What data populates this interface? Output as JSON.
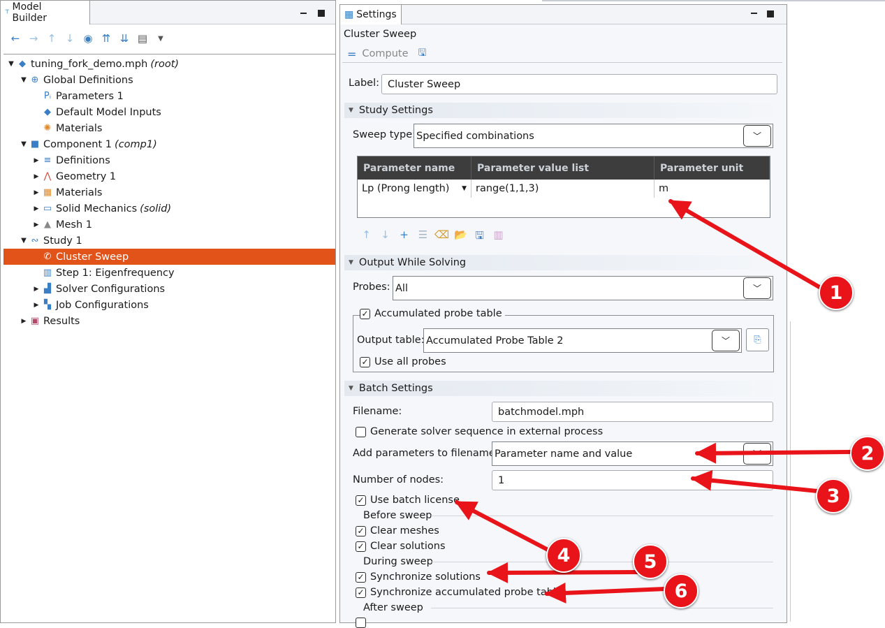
{
  "model_builder": {
    "tab_title": "Model Builder",
    "tree": [
      {
        "label": "tuning_fork_demo.mph",
        "suffix": "(root)",
        "level": 0,
        "expanded": true,
        "icon": "model-icon"
      },
      {
        "label": "Global Definitions",
        "suffix": "",
        "level": 1,
        "expanded": true,
        "icon": "globe-icon"
      },
      {
        "label": "Parameters 1",
        "suffix": "",
        "level": 2,
        "leaf": true,
        "icon": "parameters-icon"
      },
      {
        "label": "Default Model Inputs",
        "suffix": "",
        "level": 2,
        "leaf": true,
        "icon": "model-inputs-icon"
      },
      {
        "label": "Materials",
        "suffix": "",
        "level": 2,
        "leaf": true,
        "icon": "materials-global-icon"
      },
      {
        "label": "Component 1",
        "suffix": "(comp1)",
        "level": 1,
        "expanded": true,
        "icon": "component-icon"
      },
      {
        "label": "Definitions",
        "suffix": "",
        "level": 2,
        "expanded": false,
        "icon": "definitions-icon"
      },
      {
        "label": "Geometry 1",
        "suffix": "",
        "level": 2,
        "expanded": false,
        "icon": "geometry-icon"
      },
      {
        "label": "Materials",
        "suffix": "",
        "level": 2,
        "expanded": false,
        "icon": "materials-icon"
      },
      {
        "label": "Solid Mechanics",
        "suffix": "(solid)",
        "level": 2,
        "expanded": false,
        "icon": "solid-mechanics-icon"
      },
      {
        "label": "Mesh 1",
        "suffix": "",
        "level": 2,
        "expanded": false,
        "icon": "mesh-icon"
      },
      {
        "label": "Study 1",
        "suffix": "",
        "level": 1,
        "expanded": true,
        "icon": "study-icon"
      },
      {
        "label": "Cluster Sweep",
        "suffix": "",
        "level": 2,
        "leaf": true,
        "selected": true,
        "icon": "cluster-sweep-icon"
      },
      {
        "label": "Step 1: Eigenfrequency",
        "suffix": "",
        "level": 2,
        "leaf": true,
        "icon": "eigenfrequency-icon"
      },
      {
        "label": "Solver Configurations",
        "suffix": "",
        "level": 2,
        "expanded": false,
        "icon": "solver-config-icon"
      },
      {
        "label": "Job Configurations",
        "suffix": "",
        "level": 2,
        "expanded": false,
        "icon": "job-config-icon"
      },
      {
        "label": "Results",
        "suffix": "",
        "level": 1,
        "expanded": false,
        "icon": "results-icon"
      }
    ]
  },
  "settings": {
    "tab_title": "Settings",
    "node_title": "Cluster Sweep",
    "compute_label": "Compute",
    "label_field": {
      "label": "Label:",
      "value": "Cluster Sweep"
    },
    "study_settings": {
      "header": "Study Settings",
      "sweep_type_label": "Sweep type:",
      "sweep_type_value": "Specified combinations",
      "table": {
        "columns": [
          "Parameter name",
          "Parameter value list",
          "Parameter unit"
        ],
        "rows": [
          [
            "Lp (Prong length)",
            "range(1,1,3)",
            "m"
          ]
        ]
      }
    },
    "output_while_solving": {
      "header": "Output While Solving",
      "probes_label": "Probes:",
      "probes_value": "All",
      "accumulated_label": "Accumulated probe table",
      "output_table_label": "Output table:",
      "output_table_value": "Accumulated Probe Table 2",
      "use_all_probes_label": "Use all probes"
    },
    "batch_settings": {
      "header": "Batch Settings",
      "filename_label": "Filename:",
      "filename_value": "batchmodel.mph",
      "generate_solver_label": "Generate solver sequence in external process",
      "add_params_label": "Add parameters to filename:",
      "add_params_value": "Parameter name and value",
      "nodes_label": "Number of nodes:",
      "nodes_value": "1",
      "use_batch_license_label": "Use batch license",
      "before_sweep": "Before sweep",
      "clear_meshes": "Clear meshes",
      "clear_solutions": "Clear solutions",
      "during_sweep": "During sweep",
      "sync_solutions": "Synchronize solutions",
      "sync_probe_table": "Synchronize accumulated probe table",
      "after_sweep": "After sweep"
    }
  },
  "annotations": [
    "1",
    "2",
    "3",
    "4",
    "5",
    "6"
  ],
  "colors": {
    "selection": "#e25319",
    "annotation": "#e8141a",
    "table_header": "#3d3d3d",
    "icon_blue": "#3a7fc6"
  }
}
